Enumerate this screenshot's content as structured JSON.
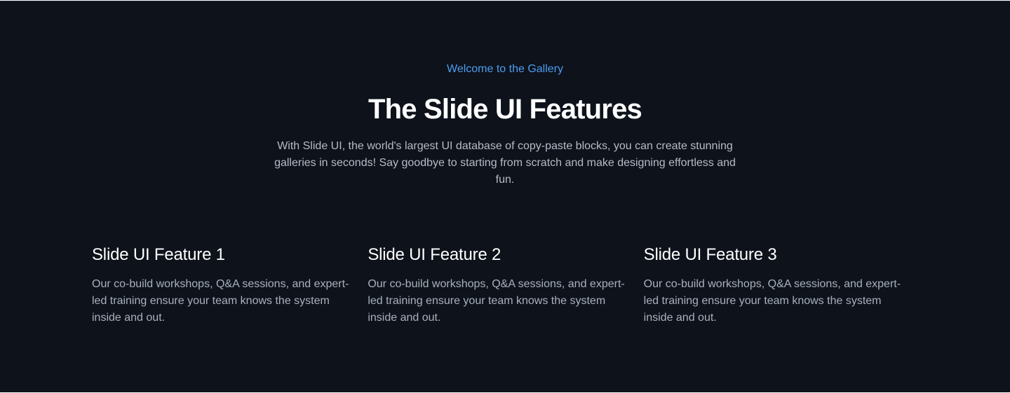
{
  "hero": {
    "eyebrow": "Welcome to the Gallery",
    "title": "The Slide UI Features",
    "description": "With Slide UI, the world's largest UI database of copy-paste blocks, you can create stunning galleries in seconds! Say goodbye to starting from scratch and make designing effortless and fun."
  },
  "features": [
    {
      "title": "Slide UI Feature 1",
      "description": "Our co-build workshops, Q&A sessions, and expert-led training ensure your team knows the system inside and out."
    },
    {
      "title": "Slide UI Feature 2",
      "description": "Our co-build workshops, Q&A sessions, and expert-led training ensure your team knows the system inside and out."
    },
    {
      "title": "Slide UI Feature 3",
      "description": "Our co-build workshops, Q&A sessions, and expert-led training ensure your team knows the system inside and out."
    }
  ],
  "colors": {
    "background": "#0d121b",
    "accent": "#4d9df0",
    "heading": "#ffffff",
    "body_text": "#aab1bc"
  }
}
